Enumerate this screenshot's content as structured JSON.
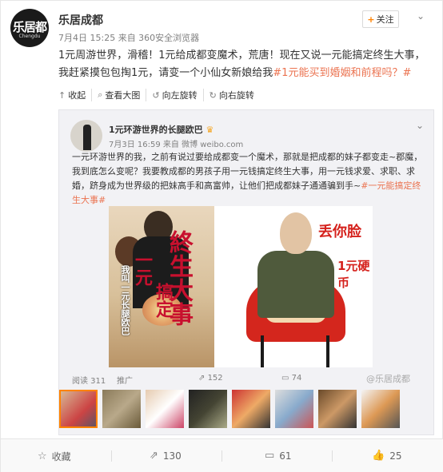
{
  "post": {
    "avatar_text": "乐居都",
    "avatar_sub": "Chengdu",
    "username": "乐居成都",
    "meta": "7月4日 15:25 来自 360安全浏览器",
    "follow_label": "关注",
    "text_plain": "1元周游世界，滑稽！1元给成都变魔术，荒唐！现在又说一元能搞定终生大事，我赶紧摸包包掏1元，请变一个小仙女新娘给我",
    "text_tag": "#1元能买到婚姻和前程吗？#"
  },
  "media_toolbar": {
    "items": [
      {
        "icon": "collapse-icon",
        "label": "收起"
      },
      {
        "icon": "zoom-icon",
        "label": "查看大图"
      },
      {
        "icon": "rotate-left-icon",
        "label": "向左旋转"
      },
      {
        "icon": "rotate-right-icon",
        "label": "向右旋转"
      }
    ]
  },
  "repost": {
    "name": "1元环游世界的长腿欧巴",
    "meta": "7月3日 16:59 来自 微博 weibo.com",
    "text_plain": "一元环游世界的我，之前有说过要给成都变一个魔术，那就是把成都的妹子都变走~郡魔，我到底怎么变呢？我要教成都的男孩子用一元钱搞定终生大事，用一元钱求爱、求职、求婚，跻身成为世界级的把妹高手和高富帅，让他们把成都妹子通通骗到手~",
    "text_tag": "#一元能搞定终生大事#",
    "image_caption1": "丢你脸",
    "image_caption2": "1元硬币",
    "poster_title": "終生大事",
    "poster_small1": "一元",
    "poster_small2": "搞定",
    "poster_scroll": "我叫一元长腿欧巴",
    "reads": "阅读 311",
    "promo": "推广",
    "forwards": "152",
    "comments": "74",
    "watermark": "@乐居成都"
  },
  "footer": {
    "favorite": "收藏",
    "forward": "130",
    "comment": "61",
    "like": "25"
  },
  "colors": {
    "accent": "#ff8200",
    "hashtag": "#eb7350",
    "caption_red": "#d5211c"
  }
}
